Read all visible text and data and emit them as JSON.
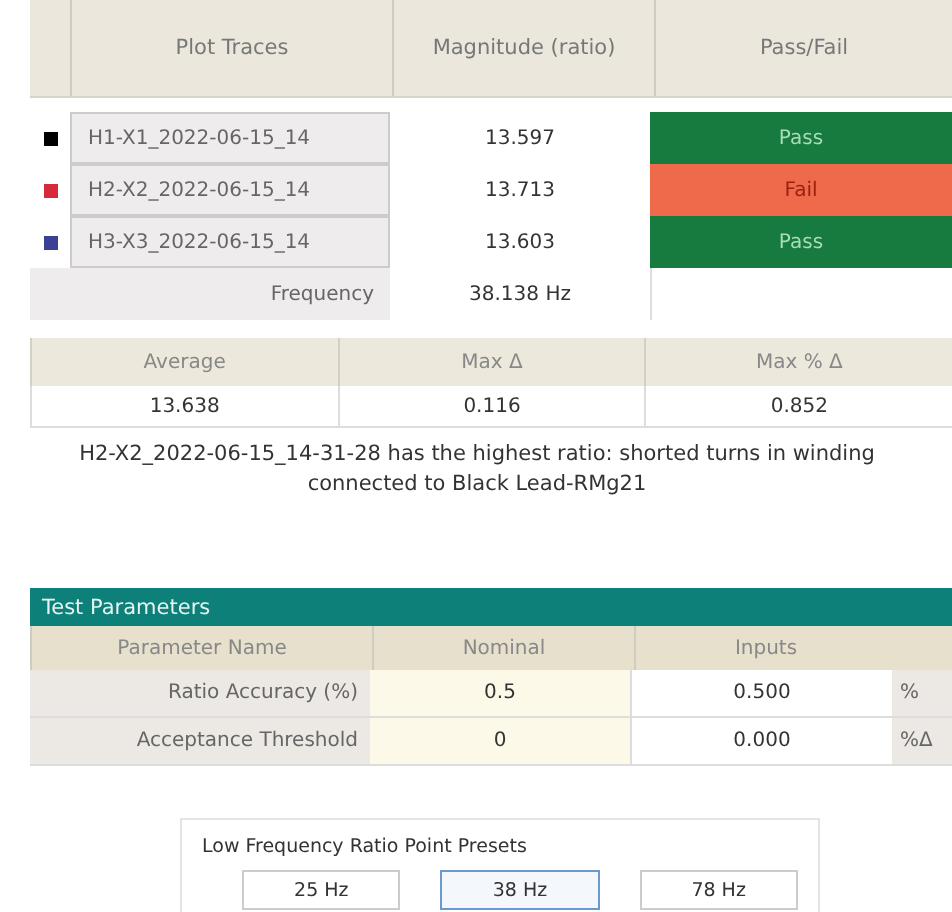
{
  "traces_table": {
    "columns": [
      "Plot Traces",
      "Magnitude (ratio)",
      "Pass/Fail"
    ],
    "rows": [
      {
        "color": "#000000",
        "trace": "H1-X1_2022-06-15_14",
        "magnitude": "13.597",
        "result": "Pass",
        "passed": true
      },
      {
        "color": "#d42a3a",
        "trace": "H2-X2_2022-06-15_14",
        "magnitude": "13.713",
        "result": "Fail",
        "passed": false
      },
      {
        "color": "#3b3f95",
        "trace": "H3-X3_2022-06-15_14",
        "magnitude": "13.603",
        "result": "Pass",
        "passed": true
      }
    ],
    "frequency_label": "Frequency",
    "frequency_value": "38.138 Hz"
  },
  "stats_table": {
    "columns": [
      "Average",
      "Max Δ",
      "Max % Δ"
    ],
    "values": [
      "13.638",
      "0.116",
      "0.852"
    ]
  },
  "message": "H2-X2_2022-06-15_14-31-28 has the highest ratio: shorted turns in winding connected to Black Lead-RMg21",
  "test_parameters": {
    "title": "Test Parameters",
    "columns": [
      "Parameter Name",
      "Nominal",
      "Inputs"
    ],
    "rows": [
      {
        "name": "Ratio Accuracy (%)",
        "nominal": "0.5",
        "input": "0.500",
        "unit": "%"
      },
      {
        "name": "Acceptance Threshold",
        "nominal": "0",
        "input": "0.000",
        "unit": "%Δ"
      }
    ]
  },
  "presets": {
    "title": "Low Frequency Ratio Point Presets",
    "buttons": [
      {
        "label": "25 Hz",
        "selected": false
      },
      {
        "label": "38 Hz",
        "selected": true
      },
      {
        "label": "78 Hz",
        "selected": false
      }
    ]
  }
}
